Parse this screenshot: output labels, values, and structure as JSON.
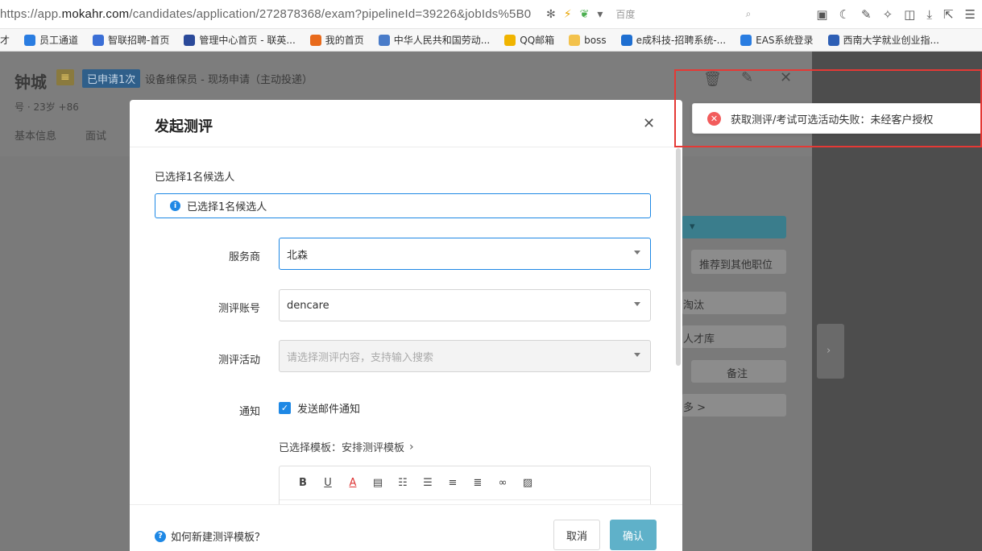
{
  "browser": {
    "url_prefix": "https://app.",
    "url_domain": "mokahr.com",
    "url_rest": "/candidates/application/272878368/exam?pipelineId=39226&jobIds%5B0",
    "search_placeholder": "百度",
    "bookmarks": [
      {
        "label": "才",
        "color": "#888888"
      },
      {
        "label": "员工通道",
        "color": "#2a7de1"
      },
      {
        "label": "智联招聘-首页",
        "color": "#3b6fd6"
      },
      {
        "label": "管理中心首页 - 联英...",
        "color": "#2b4a9a"
      },
      {
        "label": "我的首页",
        "color": "#e86a1c"
      },
      {
        "label": "中华人民共和国劳动...",
        "color": "#4a7cc9"
      },
      {
        "label": "QQ邮箱",
        "color": "#f0b400"
      },
      {
        "label": "boss",
        "color": "#f3c24c"
      },
      {
        "label": "e成科技-招聘系统-...",
        "color": "#1f6fd1"
      },
      {
        "label": "EAS系统登录",
        "color": "#2a7de1"
      },
      {
        "label": "西南大学就业创业指...",
        "color": "#2e5fb5"
      }
    ]
  },
  "candidate": {
    "name": "钟城",
    "applied_badge": "已申请1次",
    "position": "设备维保员 - 现场申请（主动投递）",
    "meta": "号 · 23岁     +86",
    "tabs": [
      "基本信息",
      "面试"
    ]
  },
  "background": {
    "recommend": "推荐到其他职位",
    "talent_pool": "人才库",
    "note": "备注",
    "more": "多 >",
    "status": "淘汰"
  },
  "modal": {
    "title": "发起测评",
    "selected_label": "已选择1名候选人",
    "selected_info": "已选择1名候选人",
    "fields": {
      "provider_label": "服务商",
      "provider_value": "北森",
      "account_label": "测评账号",
      "account_value": "dencare",
      "activity_label": "测评活动",
      "activity_placeholder": "请选择测评内容，支持输入搜索",
      "notify_label": "通知",
      "notify_checkbox": "发送邮件通知"
    },
    "template_text": "已选择模板：安排测评模板",
    "help_link": "如何新建测评模板？",
    "cancel": "取消",
    "confirm": "确认"
  },
  "toast": {
    "message": "获取测评/考试可选活动失败：未经客户授权"
  },
  "colors": {
    "primary": "#1e88e5",
    "confirm_btn": "#5fb1c9",
    "error": "#f25c5c",
    "highlight": "#e53935"
  }
}
